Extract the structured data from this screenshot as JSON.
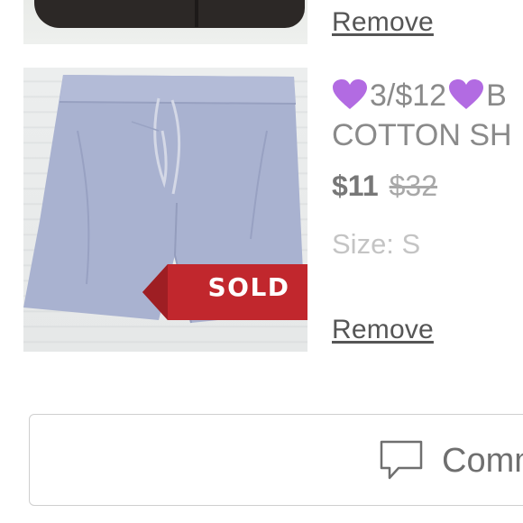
{
  "items": [
    {
      "remove_label": "Remove"
    },
    {
      "title_line1": "3/$12",
      "title_line1_suffix": "B",
      "title_line2": "COTTON SH",
      "price": "$11",
      "original_price": "$32",
      "size": "Size: S",
      "badge": "SOLD",
      "remove_label": "Remove",
      "colors": {
        "badge": "#c1272d",
        "garment": "#a9b2d0"
      }
    }
  ],
  "comment_button": {
    "label": "Comm",
    "icon": "speech-bubble-icon"
  },
  "icons": {
    "heart": "purple-heart-emoji"
  },
  "colors": {
    "heart": "#b26be2",
    "text_muted": "#8a8a8a"
  }
}
